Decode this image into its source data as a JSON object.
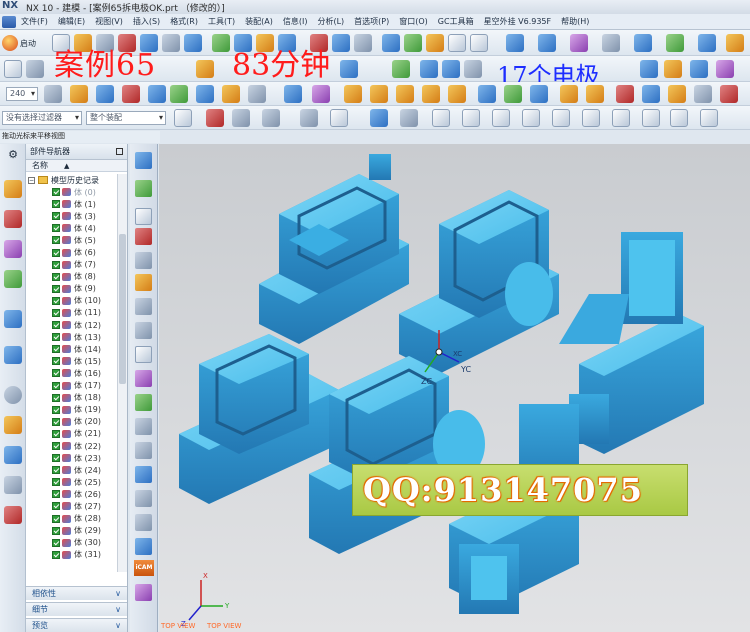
{
  "titlebar": {
    "logo": "NX",
    "title": "NX 10 - 建模 - [案例65拆电极OK.prt （修改的）]"
  },
  "menubar": {
    "items": [
      "文件(F)",
      "编辑(E)",
      "视图(V)",
      "插入(S)",
      "格式(R)",
      "工具(T)",
      "装配(A)",
      "信息(I)",
      "分析(L)",
      "首选项(P)",
      "窗口(O)",
      "GC工具箱",
      "星空外挂 V6.935F",
      "帮助(H)"
    ]
  },
  "toolbar": {
    "start_label": "启动",
    "layer_value": "240",
    "filter_placeholder": "没有选择过滤器",
    "assembly_placeholder": "整个装配"
  },
  "watermark": {
    "case": "案例65",
    "time": "83分钟",
    "electrodes": "17个电极"
  },
  "hint": "拖动光标来平移视图",
  "navigator": {
    "title": "部件导航器",
    "column": "名称",
    "root": "模型历史记录",
    "rows": [
      "体 (0)",
      "体 (1)",
      "体 (3)",
      "体 (4)",
      "体 (5)",
      "体 (6)",
      "体 (7)",
      "体 (8)",
      "体 (9)",
      "体 (10)",
      "体 (11)",
      "体 (12)",
      "体 (13)",
      "体 (14)",
      "体 (15)",
      "体 (16)",
      "体 (17)",
      "体 (18)",
      "体 (19)",
      "体 (20)",
      "体 (21)",
      "体 (22)",
      "体 (23)",
      "体 (24)",
      "体 (25)",
      "体 (26)",
      "体 (27)",
      "体 (28)",
      "体 (29)",
      "体 (30)",
      "体 (31)"
    ],
    "panels": [
      "相依性",
      "细节",
      "预览"
    ]
  },
  "selection_strip": {
    "icam": "iCAM"
  },
  "viewport": {
    "axis_xc": "XC",
    "axis_yc": "YC",
    "axis_zc": "ZC",
    "axis_x": "X",
    "axis_y": "Y",
    "axis_z": "Z",
    "view_label": "TOP VIEW",
    "view_label_2": "TOP VIEW"
  },
  "banner": {
    "qq": "QQ:913147075"
  },
  "colors": {
    "part_fill": "#4ec3ee",
    "part_shadow": "#2a86c2",
    "watermark_red": "#ff1c1c",
    "watermark_blue": "#1d2dff",
    "banner_green": "#b4d052"
  }
}
